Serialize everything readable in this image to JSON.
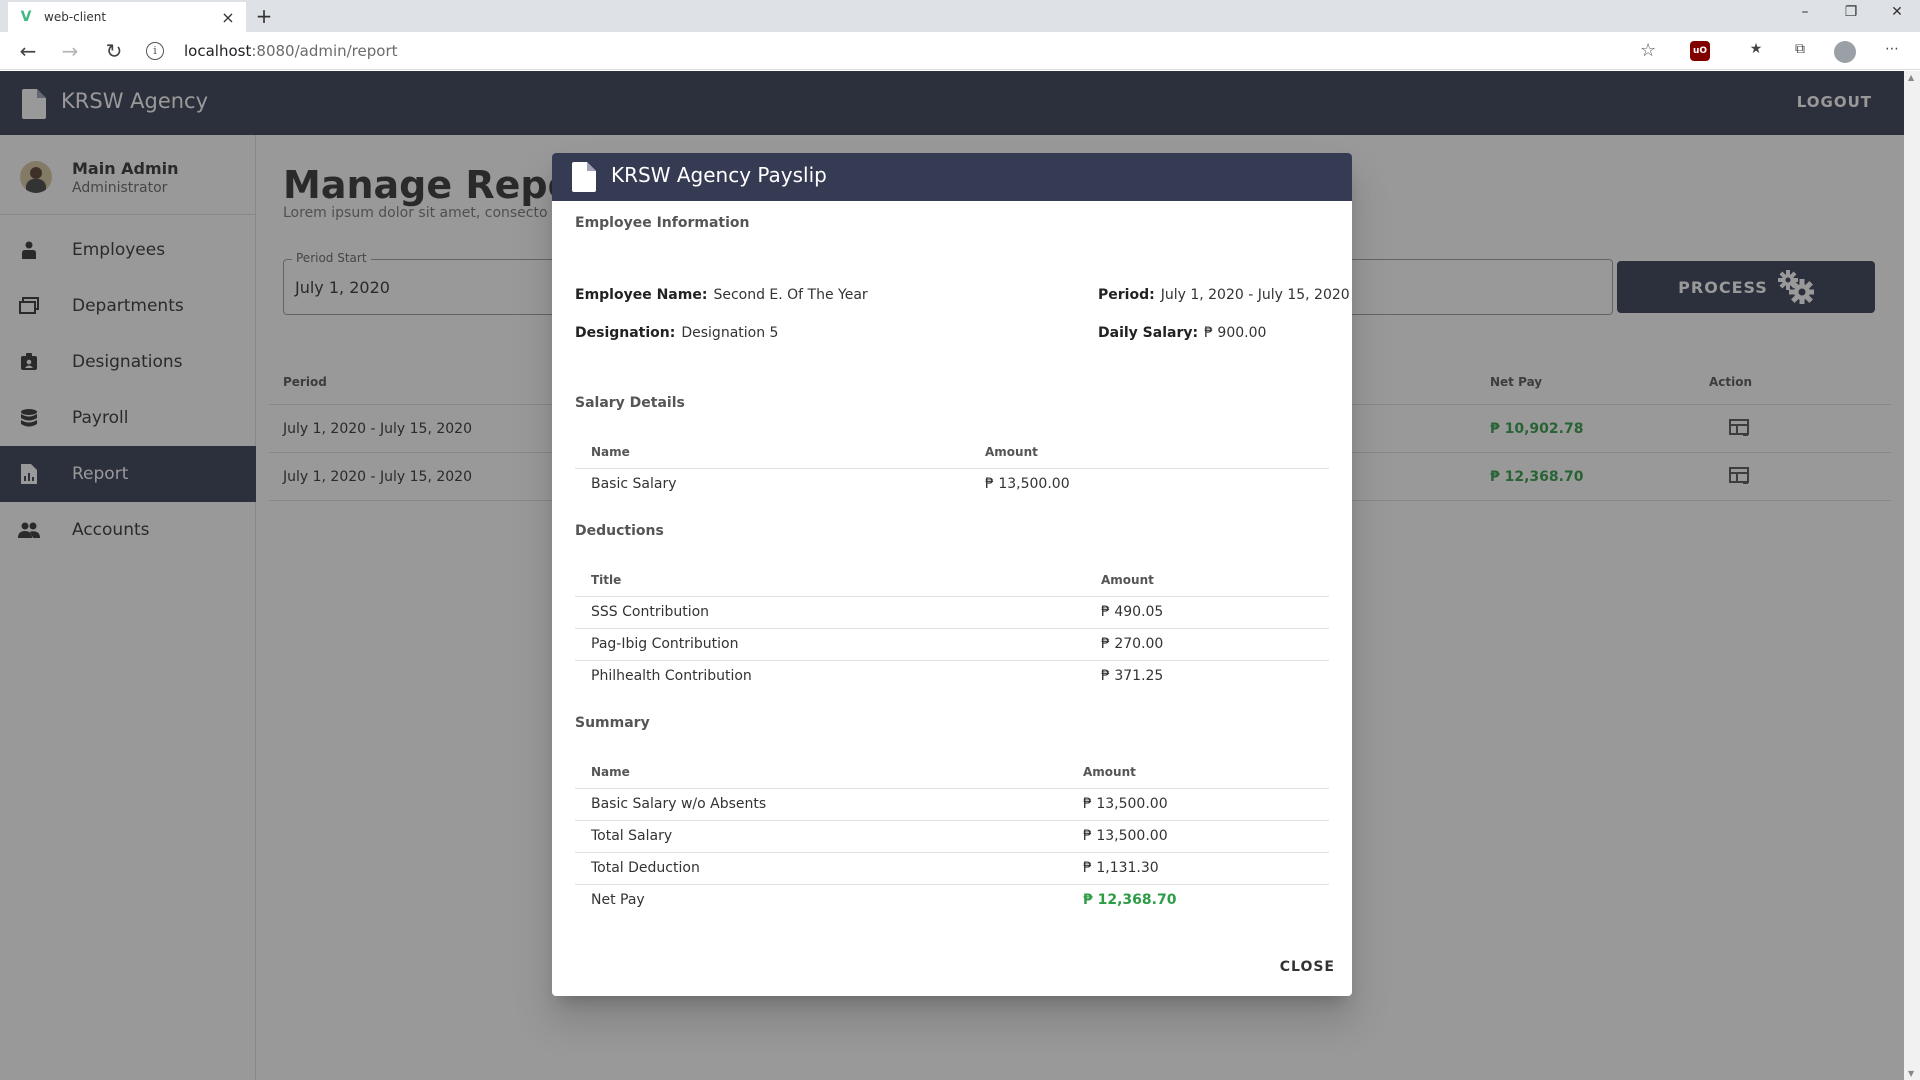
{
  "browser": {
    "tab_title": "web-client",
    "url_host": "localhost",
    "url_path": ":8080/admin/report"
  },
  "app": {
    "title": "KRSW Agency",
    "logout_label": "LOGOUT"
  },
  "user": {
    "name": "Main Admin",
    "role": "Administrator"
  },
  "sidebar": {
    "items": [
      {
        "label": "Employees",
        "icon": "employee-icon"
      },
      {
        "label": "Departments",
        "icon": "departments-icon"
      },
      {
        "label": "Designations",
        "icon": "badge-icon"
      },
      {
        "label": "Payroll",
        "icon": "database-icon"
      },
      {
        "label": "Report",
        "icon": "report-icon",
        "active": true
      },
      {
        "label": "Accounts",
        "icon": "accounts-icon"
      }
    ]
  },
  "main": {
    "title": "Manage Report",
    "subtitle": "Lorem ipsum dolor sit amet, consecto",
    "period_start_label": "Period Start",
    "period_start_value": "July 1, 2020",
    "process_label": "PROCESS",
    "table": {
      "headers": {
        "period": "Period",
        "net_pay": "Net Pay",
        "action": "Action"
      },
      "rows": [
        {
          "period": "July 1, 2020 - July 15, 2020",
          "net_pay": "₱ 10,902.78"
        },
        {
          "period": "July 1, 2020 - July 15, 2020",
          "net_pay": "₱ 12,368.70"
        }
      ]
    }
  },
  "dialog": {
    "title": "KRSW Agency Payslip",
    "employee_info_title": "Employee Information",
    "employee_name_label": "Employee Name:",
    "employee_name_value": "Second E. Of The Year",
    "designation_label": "Designation:",
    "designation_value": "Designation 5",
    "period_label": "Period:",
    "period_value": "July 1, 2020 - July 15, 2020",
    "daily_salary_label": "Daily Salary:",
    "daily_salary_value": "₱ 900.00",
    "salary_details": {
      "title": "Salary Details",
      "headers": {
        "name": "Name",
        "amount": "Amount"
      },
      "rows": [
        {
          "name": "Basic Salary",
          "amount": "₱ 13,500.00"
        }
      ]
    },
    "deductions": {
      "title": "Deductions",
      "headers": {
        "name": "Title",
        "amount": "Amount"
      },
      "rows": [
        {
          "name": "SSS Contribution",
          "amount": "₱ 490.05"
        },
        {
          "name": "Pag-Ibig Contribution",
          "amount": "₱ 270.00"
        },
        {
          "name": "Philhealth Contribution",
          "amount": "₱ 371.25"
        }
      ]
    },
    "summary": {
      "title": "Summary",
      "headers": {
        "name": "Name",
        "amount": "Amount"
      },
      "rows": [
        {
          "name": "Basic Salary w/o Absents",
          "amount": "₱ 13,500.00"
        },
        {
          "name": "Total Salary",
          "amount": "₱ 13,500.00"
        },
        {
          "name": "Total Deduction",
          "amount": "₱ 1,131.30"
        },
        {
          "name": "Net Pay",
          "amount": "₱ 12,368.70"
        }
      ]
    },
    "close_label": "CLOSE"
  },
  "colors": {
    "primary": "#363b54",
    "net_pay_green": "#2e9c46"
  }
}
